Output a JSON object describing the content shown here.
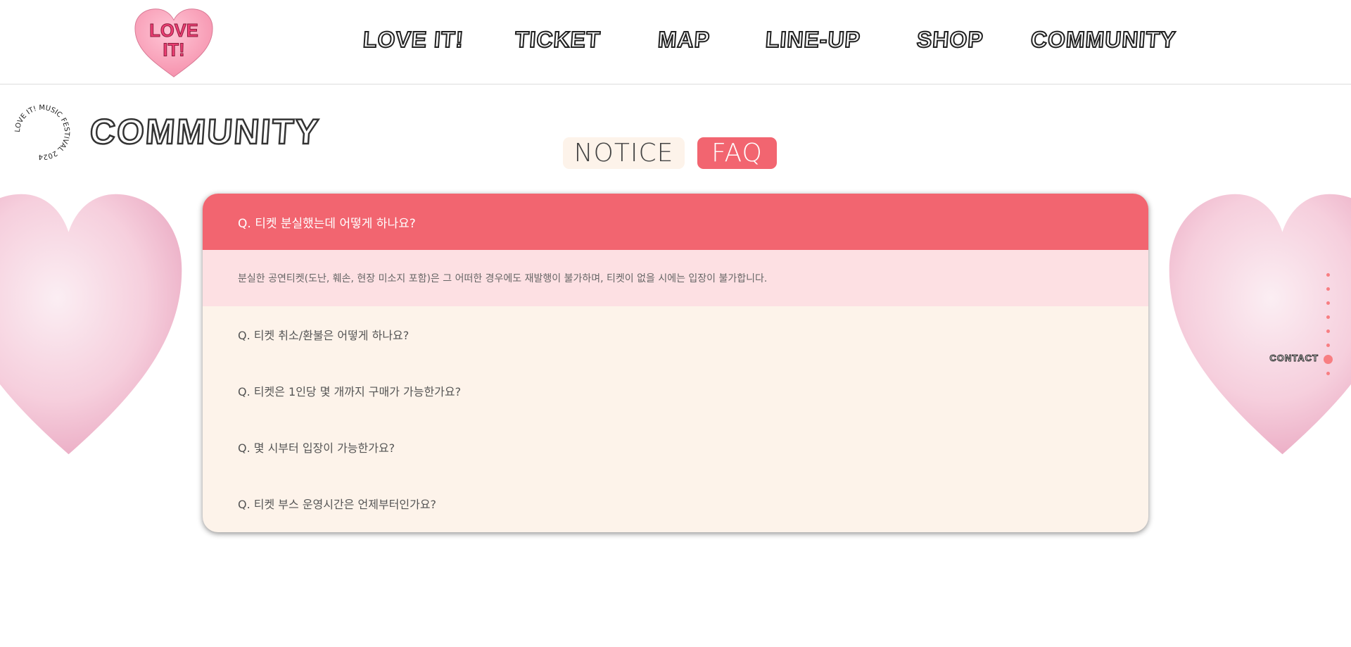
{
  "header": {
    "logo_text": "LOVE IT!",
    "nav": [
      "LOVE IT!",
      "TICKET",
      "MAP",
      "LINE-UP",
      "SHOP",
      "COMMUNITY"
    ]
  },
  "page": {
    "badge_text": "LOVE IT! MUSIC FESTIVAL 2024 ",
    "title": "COMMUNITY"
  },
  "tabs": [
    {
      "label": "NOTICE",
      "active": false
    },
    {
      "label": "FAQ",
      "active": true
    }
  ],
  "faq": {
    "open_question": "Q. 티켓 분실했는데 어떻게 하나요?",
    "open_answer": "분실한 공연티켓(도난, 훼손, 현장 미소지 포함)은 그 어떠한 경우에도 재발행이 불가하며, 티켓이 없을 시에는 입장이 불가합니다.",
    "questions": [
      "Q. 티켓 취소/환불은 어떻게 하나요?",
      "Q. 티켓은 1인당 몇 개까지 구매가 가능한가요?",
      "Q. 몇 시부터 입장이 가능한가요?",
      "Q. 티켓 부스 운영시간은 언제부터인가요?"
    ]
  },
  "side_nav": {
    "active_label": "CONTACT"
  },
  "colors": {
    "accent": "#f26570",
    "cream": "#fdf3ea",
    "answer_bg": "#fde0e3",
    "dot": "#f87e82"
  }
}
